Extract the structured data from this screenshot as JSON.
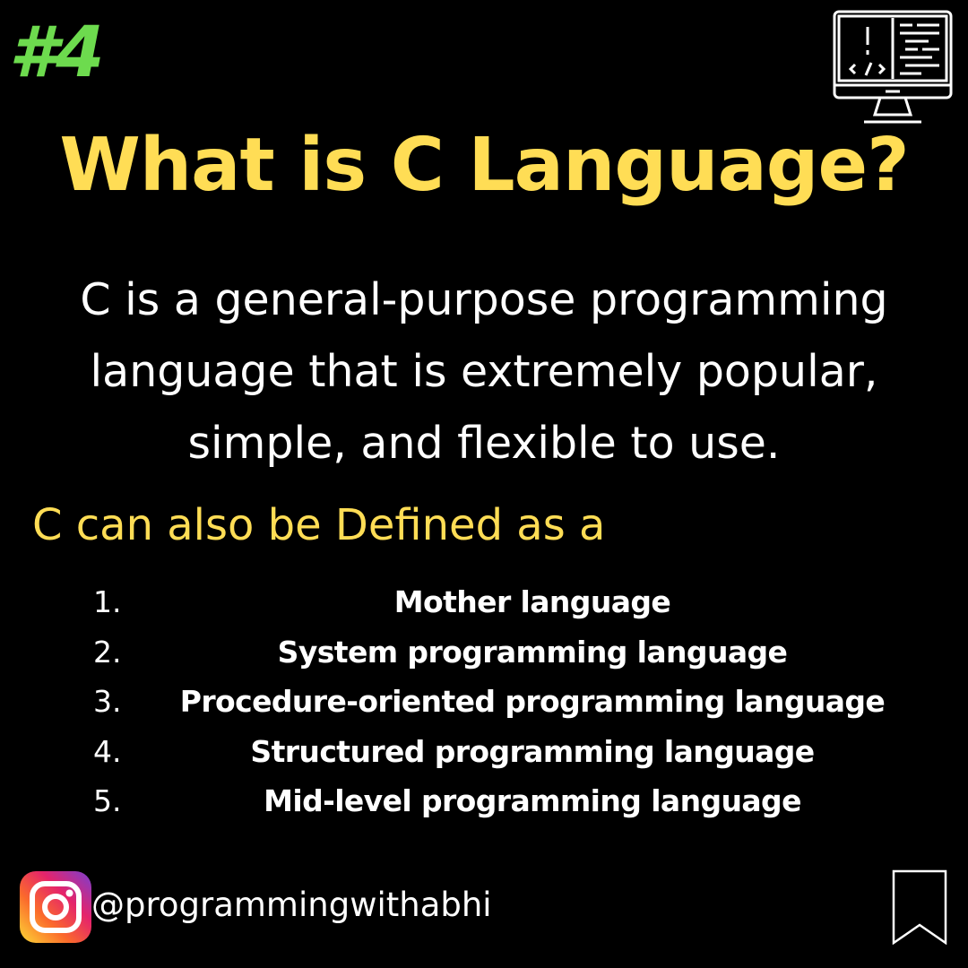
{
  "badge": "#4",
  "title": "What is C Language?",
  "description": {
    "lines": [
      "C is a general-purpose programming",
      "language that is extremely popular,",
      "simple, and flexible to use."
    ]
  },
  "subheading": "C can also be Defined as a",
  "definitions": [
    {
      "num": "1.",
      "text": "Mother language"
    },
    {
      "num": "2.",
      "text": "System programming language"
    },
    {
      "num": "3.",
      "text": "Procedure-oriented programming language"
    },
    {
      "num": "4.",
      "text": "Structured programming language"
    },
    {
      "num": "5.",
      "text": "Mid-level programming language"
    }
  ],
  "footer": {
    "handle": "@programmingwithabhi",
    "icons": [
      "instagram-icon",
      "bookmark-icon"
    ]
  },
  "header_icon": "computer-code-icon",
  "colors": {
    "background": "#000000",
    "badge": "#6ddb4e",
    "title": "#ffdd55",
    "text": "#ffffff"
  }
}
